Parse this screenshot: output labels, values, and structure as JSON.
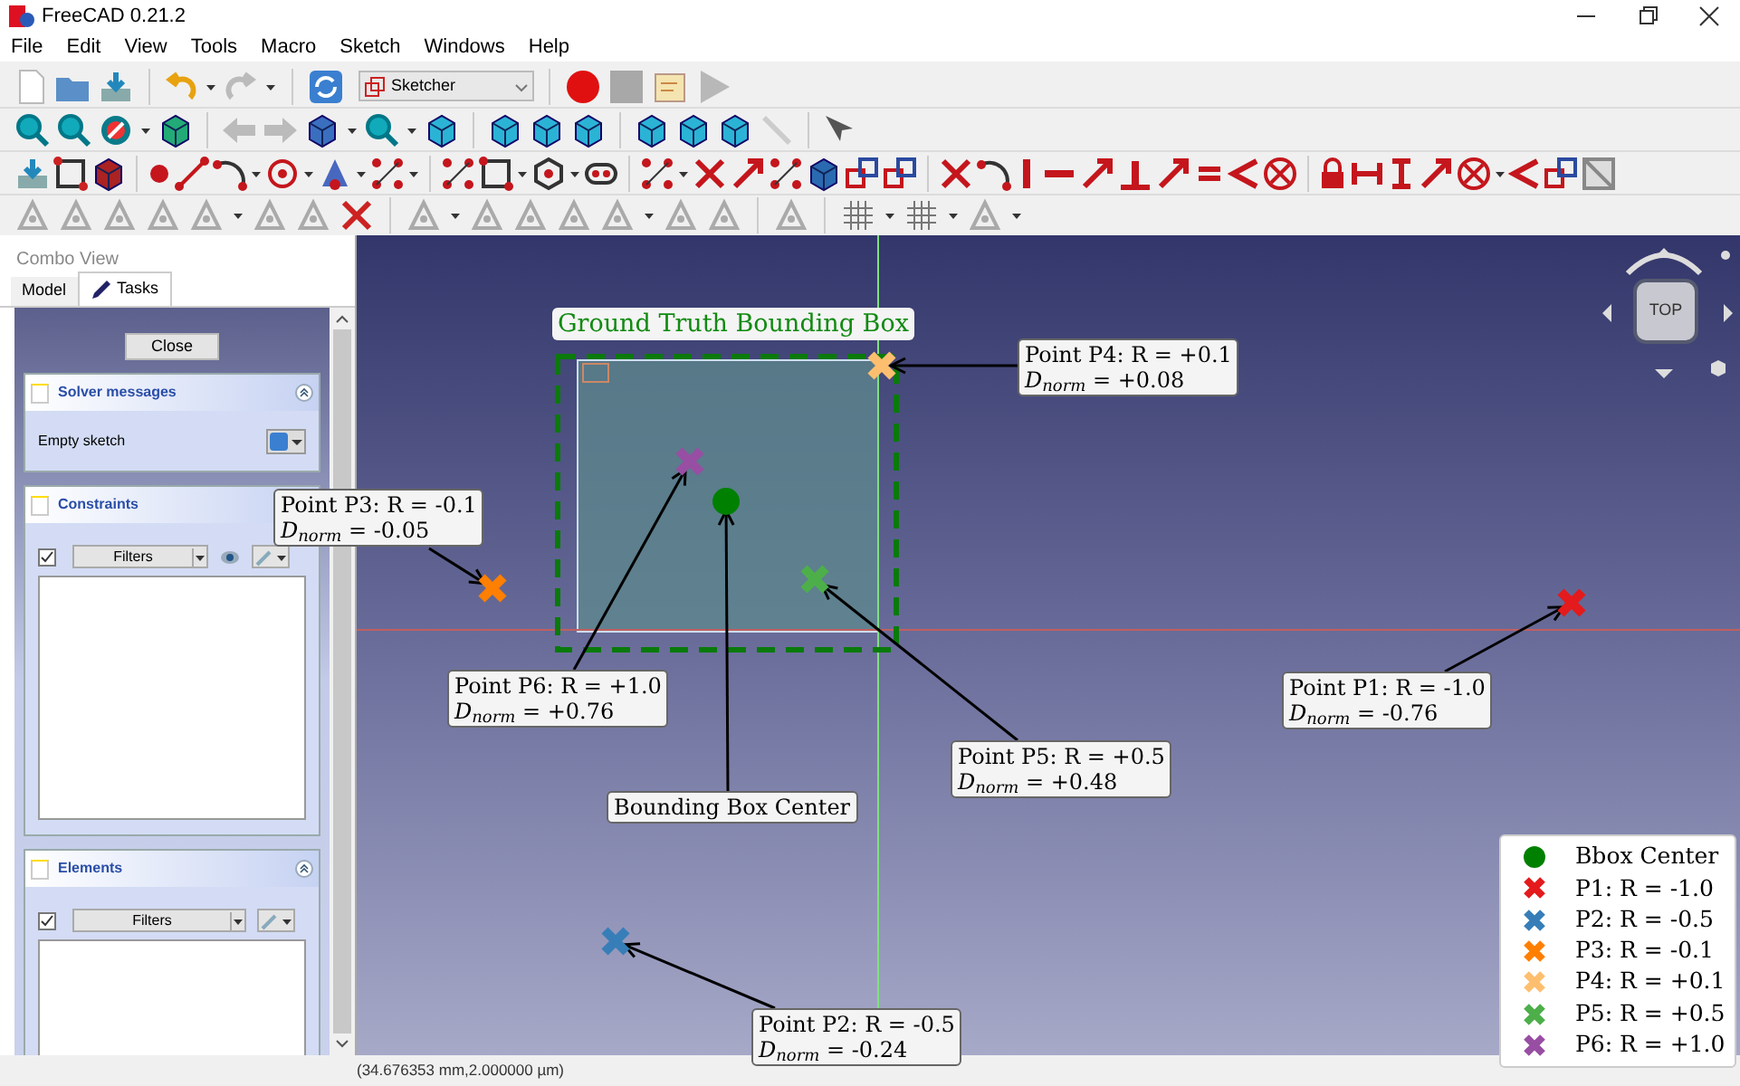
{
  "window": {
    "title": "FreeCAD 0.21.2"
  },
  "menu": [
    "File",
    "Edit",
    "View",
    "Tools",
    "Macro",
    "Sketch",
    "Windows",
    "Help"
  ],
  "workbench": {
    "value": "Sketcher"
  },
  "combo_view": {
    "title": "Combo View",
    "tabs": [
      {
        "label": "Model",
        "selected": false
      },
      {
        "label": "Tasks",
        "selected": true
      }
    ],
    "close_button": "Close",
    "panels": [
      {
        "title": "Solver messages",
        "kind": "message",
        "text": "Empty sketch"
      },
      {
        "title": "Constraints",
        "kind": "list",
        "checked": true,
        "filter": "Filters",
        "eye": true
      },
      {
        "title": "Elements",
        "kind": "list",
        "checked": true,
        "filter": "Filters",
        "eye": false
      }
    ]
  },
  "viewport": {
    "nav_cube": "TOP",
    "region_label": "Ground Truth Bounding Box",
    "annotations": [
      {
        "kind": "cross",
        "color": "#fdbf6f",
        "title": "Point P4: R = +0.1",
        "metric": "*D*$_{norm}$ = +0.08"
      },
      {
        "kind": "cross",
        "color": "#ff7f00",
        "title": "Point P3: R = -0.1",
        "metric": "*D*$_{norm}$ = -0.05"
      },
      {
        "kind": "cross",
        "color": "#984ea3",
        "title": "Point P6: R = +1.0",
        "metric": "*D*$_{norm}$ = +0.76"
      },
      {
        "kind": "cross",
        "color": "#4daf4a",
        "title": "Point P5: R = +0.5",
        "metric": "*D*$_{norm}$ = +0.48"
      },
      {
        "kind": "cross",
        "color": "#e41a1c",
        "title": "Point P1: R = -1.0",
        "metric": "*D*$_{norm}$ = -0.76"
      },
      {
        "kind": "circle",
        "color": "#008000",
        "title": "Bounding Box Center"
      },
      {
        "kind": "cross",
        "color": "#377eb8",
        "title": "Point P2: R = -0.5",
        "metric": "*D*$_{norm}$ = -0.24"
      }
    ],
    "legend": [
      {
        "kind": "circle",
        "color": "#008000",
        "label": "Bbox Center"
      },
      {
        "kind": "cross",
        "color": "#e41a1c",
        "label": "P1: R = -1.0"
      },
      {
        "kind": "cross",
        "color": "#377eb8",
        "label": "P2: R = -0.5"
      },
      {
        "kind": "cross",
        "color": "#ff7f00",
        "label": "P3: R = -0.1"
      },
      {
        "kind": "cross",
        "color": "#fdbf6f",
        "label": "P4: R = +0.1"
      },
      {
        "kind": "cross",
        "color": "#4daf4a",
        "label": "P5: R = +0.5"
      },
      {
        "kind": "cross",
        "color": "#984ea3",
        "label": "P6: R = +1.0"
      }
    ]
  },
  "status_bar": {
    "text": "(34.676353 mm,2.000000 µm)"
  }
}
